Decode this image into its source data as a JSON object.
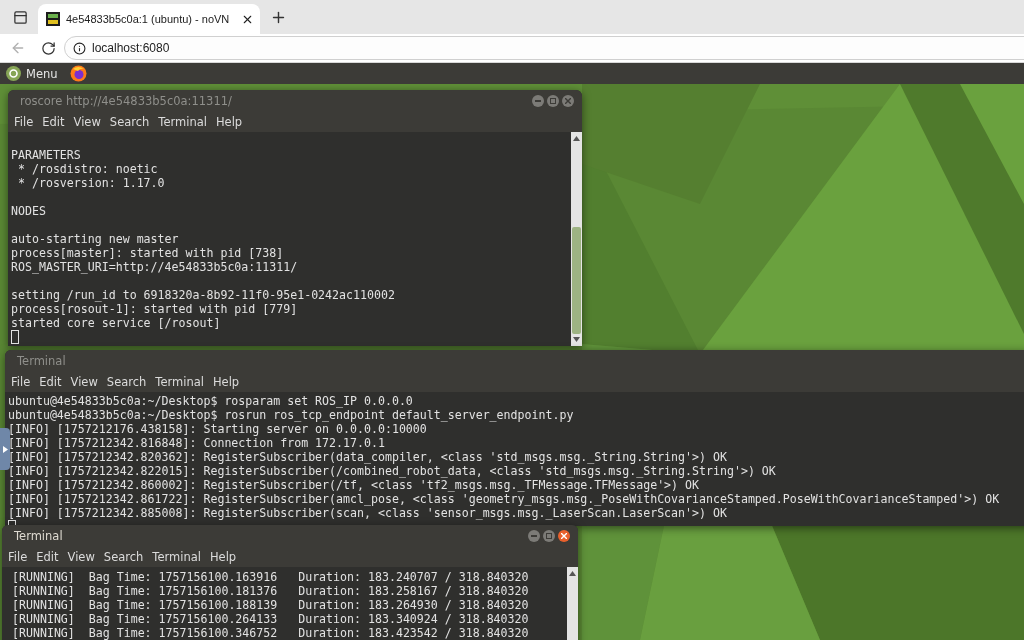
{
  "browser": {
    "tabs": [
      {
        "title": "4e54833b5c0a:1 (ubuntu) - noVN",
        "selected": true
      }
    ],
    "address": "localhost:6080"
  },
  "panel": {
    "menu_label": "Menu"
  },
  "windows": [
    {
      "title": "roscore http://4e54833b5c0a:11311/",
      "active": false,
      "controls": true,
      "scrollbar": true,
      "menu": [
        "File",
        "Edit",
        "View",
        "Search",
        "Terminal",
        "Help"
      ],
      "cursor": true,
      "blocks": [
        [
          "PARAMETERS",
          " * /rosdistro: noetic",
          " * /rosversion: 1.17.0"
        ],
        [
          "NODES"
        ],
        [
          "auto-starting new master",
          "process[master]: started with pid [738]",
          "ROS_MASTER_URI=http://4e54833b5c0a:11311/"
        ],
        [
          "setting /run_id to 6918320a-8b92-11f0-95e1-0242ac110002",
          "process[rosout-1]: started with pid [779]",
          "started core service [/rosout]"
        ]
      ]
    },
    {
      "title": "Terminal",
      "active": false,
      "controls": false,
      "scrollbar": false,
      "menu": [
        "File",
        "Edit",
        "View",
        "Search",
        "Terminal",
        "Help"
      ],
      "cursor": true,
      "blocks": [
        [
          "ubuntu@4e54833b5c0a:~/Desktop$ rosparam set ROS_IP 0.0.0.0",
          "ubuntu@4e54833b5c0a:~/Desktop$ rosrun ros_tcp_endpoint default_server_endpoint.py",
          "[INFO] [1757212176.438158]: Starting server on 0.0.0.0:10000",
          "[INFO] [1757212342.816848]: Connection from 172.17.0.1",
          "[INFO] [1757212342.820362]: RegisterSubscriber(data_compiler, <class 'std_msgs.msg._String.String'>) OK",
          "[INFO] [1757212342.822015]: RegisterSubscriber(/combined_robot_data, <class 'std_msgs.msg._String.String'>) OK",
          "[INFO] [1757212342.860002]: RegisterSubscriber(/tf, <class 'tf2_msgs.msg._TFMessage.TFMessage'>) OK",
          "[INFO] [1757212342.861722]: RegisterSubscriber(amcl_pose, <class 'geometry_msgs.msg._PoseWithCovarianceStamped.PoseWithCovarianceStamped'>) OK",
          "[INFO] [1757212342.885008]: RegisterSubscriber(scan, <class 'sensor_msgs.msg._LaserScan.LaserScan'>) OK"
        ]
      ]
    },
    {
      "title": "Terminal",
      "active": true,
      "controls": true,
      "scrollbar": true,
      "menu": [
        "File",
        "Edit",
        "View",
        "Search",
        "Terminal",
        "Help"
      ],
      "blocks": [
        [
          "[RUNNING]  Bag Time: 1757156100.163916   Duration: 183.240707 / 318.840320",
          "[RUNNING]  Bag Time: 1757156100.181376   Duration: 183.258167 / 318.840320",
          "[RUNNING]  Bag Time: 1757156100.188139   Duration: 183.264930 / 318.840320",
          "[RUNNING]  Bag Time: 1757156100.264133   Duration: 183.340924 / 318.840320",
          "[RUNNING]  Bag Time: 1757156100.346752   Duration: 183.423542 / 318.840320"
        ]
      ]
    }
  ]
}
